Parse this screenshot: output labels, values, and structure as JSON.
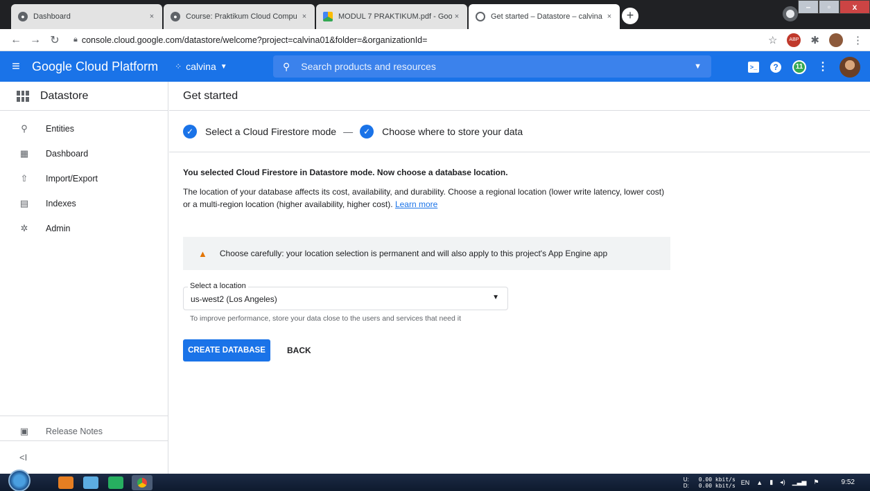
{
  "browser": {
    "tabs": [
      {
        "title": "Dashboard",
        "active": false
      },
      {
        "title": "Course: Praktikum Cloud Compu",
        "active": false
      },
      {
        "title": "MODUL 7 PRAKTIKUM.pdf - Goo",
        "active": false
      },
      {
        "title": "Get started – Datastore – calvina",
        "active": true
      }
    ],
    "close_glyph": "×",
    "new_tab_glyph": "+",
    "url": "console.cloud.google.com/datastore/welcome?project=calvina01&folder=&organizationId="
  },
  "gcp": {
    "brand": "Google Cloud Platform",
    "project": "calvina",
    "search_placeholder": "Search products and resources",
    "notification_count": "11"
  },
  "sidebar": {
    "title": "Datastore",
    "items": [
      {
        "label": "Entities",
        "icon": "search-icon"
      },
      {
        "label": "Dashboard",
        "icon": "dashboard-icon"
      },
      {
        "label": "Import/Export",
        "icon": "upload-icon"
      },
      {
        "label": "Indexes",
        "icon": "index-icon"
      },
      {
        "label": "Admin",
        "icon": "gear-icon"
      }
    ],
    "release_notes": "Release Notes",
    "collapse_glyph": "<I"
  },
  "main": {
    "page_title": "Get started",
    "steps": [
      "Select a Cloud Firestore mode",
      "Choose where to store your data"
    ],
    "step_separator": "—",
    "heading": "You selected Cloud Firestore in Datastore mode. Now choose a database location.",
    "description_line1": "The location of your database affects its cost, availability, and durability. Choose a regional location (lower write latency, lower cost)",
    "description_line2": "or a multi-region location (higher availability, higher cost).",
    "learn_more": "Learn more",
    "warning": "Choose carefully: your location selection is permanent and will also apply to this project's App Engine app",
    "select_label": "Select a location",
    "select_value": "us-west2 (Los Angeles)",
    "hint": "To improve performance, store your data close to the users and services that need it",
    "primary_button": "CREATE DATABASE",
    "back_button": "BACK"
  },
  "taskbar": {
    "net_up_label": "U:",
    "net_down_label": "D:",
    "net_up": "0.00 kbit/s",
    "net_down": "0.00 kbit/s",
    "lang": "EN",
    "time": "9:52"
  },
  "colors": {
    "gcp_blue": "#1a73e8",
    "warning_orange": "#e37400",
    "notification_green": "#34a853"
  }
}
